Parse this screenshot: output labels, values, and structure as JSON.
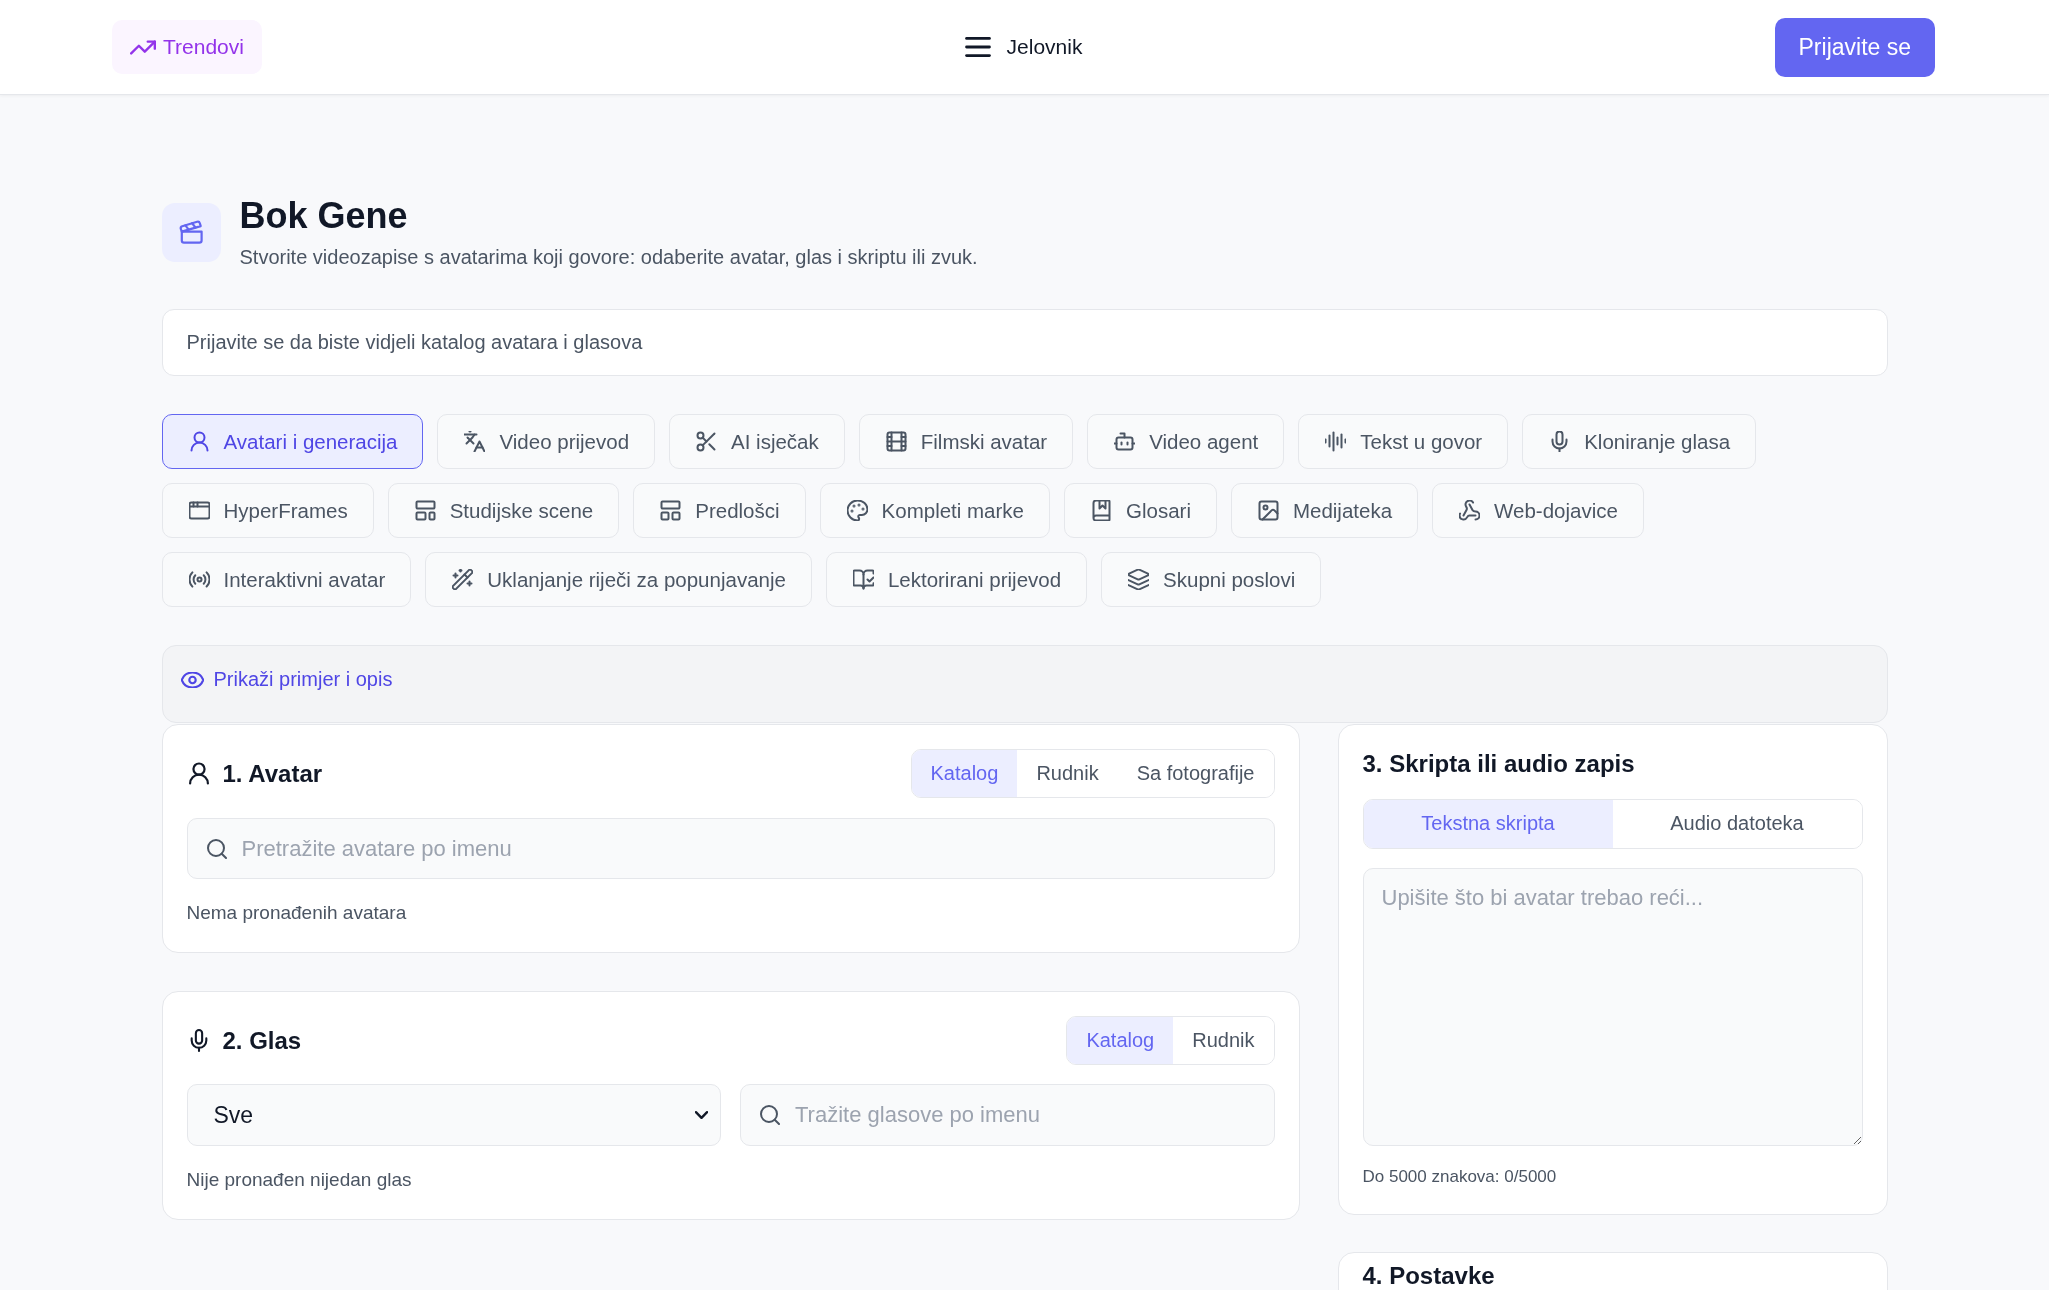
{
  "header": {
    "trending_link": "Trendovi",
    "menu_button": "Jelovnik",
    "login_button": "Prijavite se"
  },
  "page_title": {
    "title": "Bok Gene",
    "subtitle": "Stvorite videozapise s avatarima koji govore: odaberite avatar, glas i skriptu ili zvuk."
  },
  "login_notice": "Prijavite se da biste vidjeli katalog avatara i glasova",
  "tabs": [
    {
      "label": "Avatari i generacija",
      "selected": true
    },
    {
      "label": "Video prijevod",
      "selected": false
    },
    {
      "label": "AI isječak",
      "selected": false
    },
    {
      "label": "Filmski avatar",
      "selected": false
    },
    {
      "label": "Video agent",
      "selected": false
    },
    {
      "label": "Tekst u govor",
      "selected": false
    },
    {
      "label": "Kloniranje glasa",
      "selected": false
    },
    {
      "label": "HyperFrames",
      "selected": false
    },
    {
      "label": "Studijske scene",
      "selected": false
    },
    {
      "label": "Predlošci",
      "selected": false
    },
    {
      "label": "Kompleti marke",
      "selected": false
    },
    {
      "label": "Glosari",
      "selected": false
    },
    {
      "label": "Medijateka",
      "selected": false
    },
    {
      "label": "Web-dojavice",
      "selected": false
    },
    {
      "label": "Interaktivni avatar",
      "selected": false
    },
    {
      "label": "Uklanjanje riječi za popunjavanje",
      "selected": false
    },
    {
      "label": "Lektorirani prijevod",
      "selected": false
    },
    {
      "label": "Skupni poslovi",
      "selected": false
    }
  ],
  "example_toggle": {
    "label": "Prikaži primjer i opis"
  },
  "avatar_section": {
    "title": "1. Avatar",
    "source_tabs": [
      {
        "label": "Katalog",
        "selected": true
      },
      {
        "label": "Rudnik",
        "selected": false
      },
      {
        "label": "Sa fotografije",
        "selected": false
      }
    ],
    "search": {
      "placeholder": "Pretražite avatare po imenu"
    },
    "empty_message": "Nema pronađenih avatara"
  },
  "voice_section": {
    "title": "2. Glas",
    "source_tabs": [
      {
        "label": "Katalog",
        "selected": true
      },
      {
        "label": "Rudnik",
        "selected": false
      }
    ],
    "filter": {
      "value": "Sve"
    },
    "search": {
      "placeholder": "Tražite glasove po imenu"
    },
    "empty_message": "Nije pronađen nijedan glas"
  },
  "script_section": {
    "title": "3. Skripta ili audio zapis",
    "mode_tabs": [
      {
        "label": "Tekstna skripta",
        "selected": true
      },
      {
        "label": "Audio datoteka",
        "selected": false
      }
    ],
    "script": {
      "placeholder": "Upišite što bi avatar trebao reći..."
    },
    "char_counter": "Do 5000 znakova: 0/5000"
  },
  "settings_section": {
    "title": "4. Postavke"
  }
}
